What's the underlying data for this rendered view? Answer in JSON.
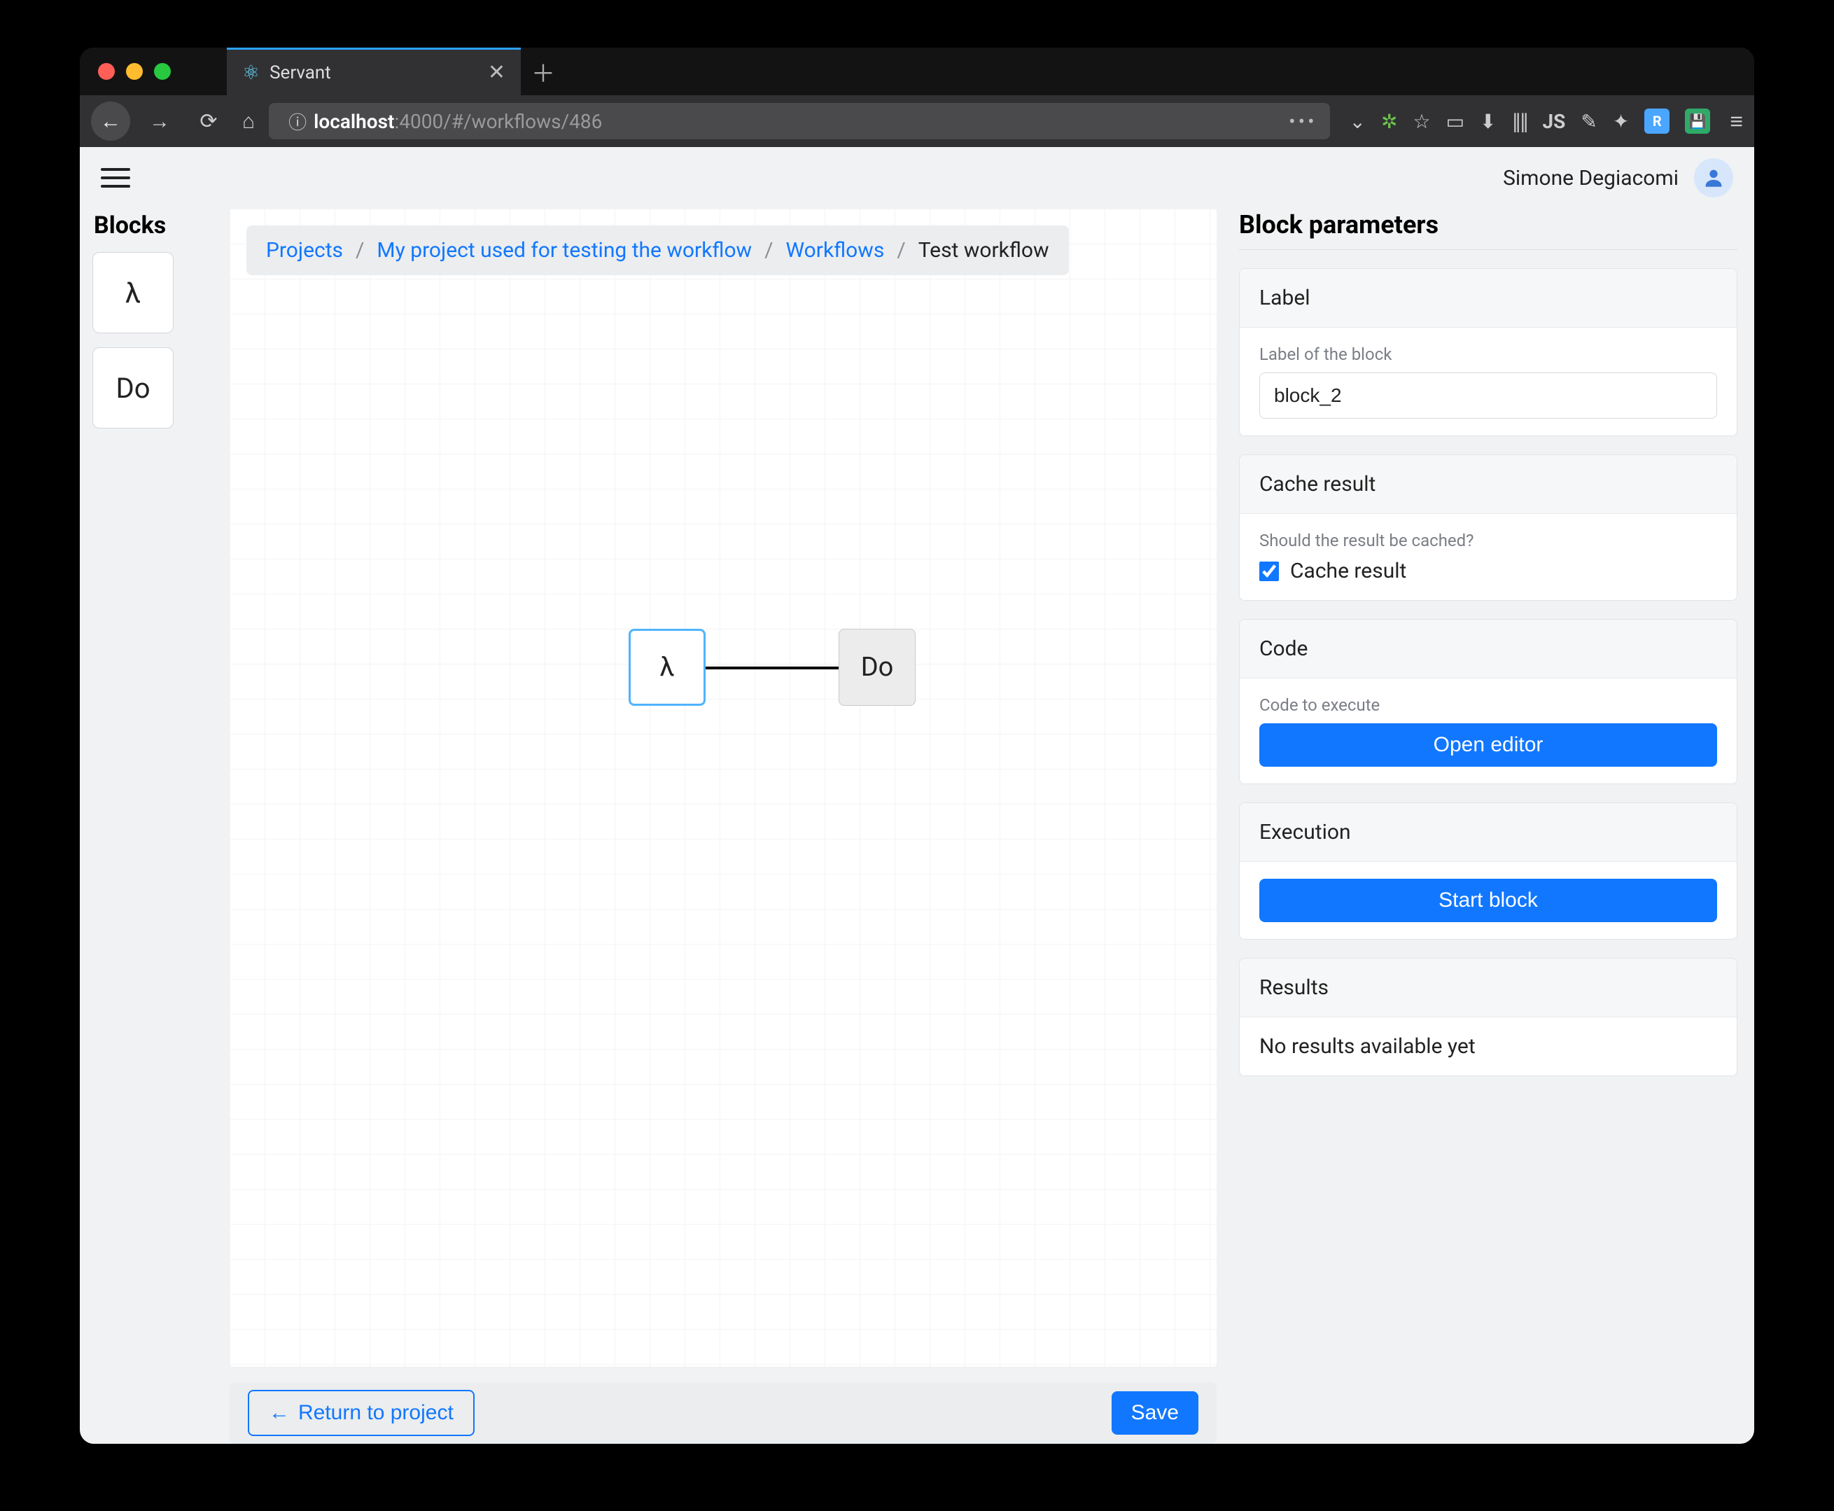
{
  "browser": {
    "tab_title": "Servant",
    "url_host_strong": "localhost",
    "url_host_rest": ":4000/#/workflows/486"
  },
  "appbar": {
    "user_name": "Simone Degiacomi"
  },
  "sidebar": {
    "heading": "Blocks",
    "items": [
      {
        "label": "λ"
      },
      {
        "label": "Do"
      }
    ]
  },
  "breadcrumb": {
    "projects": "Projects",
    "project_name": "My project used for testing the workflow",
    "workflows": "Workflows",
    "current": "Test workflow"
  },
  "canvas": {
    "node_lambda": "λ",
    "node_do": "Do"
  },
  "footer": {
    "return_label": "Return to project",
    "save_label": "Save"
  },
  "rightpanel": {
    "title": "Block parameters",
    "label_section": {
      "header": "Label",
      "field_hint": "Label of the block",
      "value": "block_2"
    },
    "cache_section": {
      "header": "Cache result",
      "hint": "Should the result be cached?",
      "checkbox_label": "Cache result",
      "checked": true
    },
    "code_section": {
      "header": "Code",
      "hint": "Code to execute",
      "button": "Open editor"
    },
    "exec_section": {
      "header": "Execution",
      "button": "Start block"
    },
    "results_section": {
      "header": "Results",
      "empty": "No results available yet"
    }
  }
}
